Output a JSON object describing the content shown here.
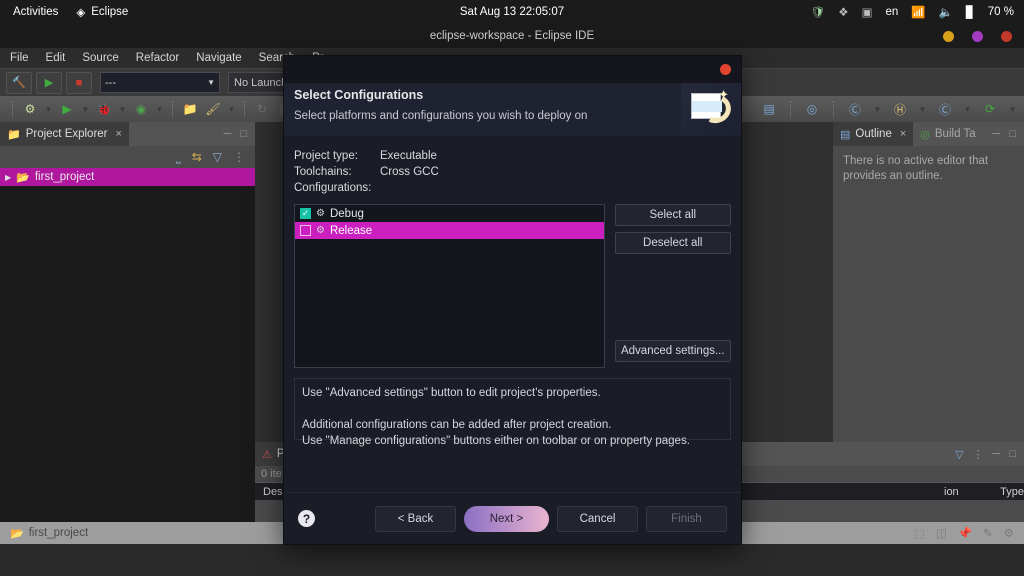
{
  "gnome": {
    "activities": "Activities",
    "app_name": "Eclipse",
    "app_icon": "eclipse-icon",
    "clock": "Sat Aug 13  22:05:07",
    "tray": [
      {
        "name": "shield-icon",
        "glyph": "⬟"
      },
      {
        "name": "dropbox-icon",
        "glyph": "⬡"
      },
      {
        "name": "device-icon",
        "glyph": "▣"
      },
      {
        "name": "keyboard-language",
        "glyph": "en"
      },
      {
        "name": "wifi-icon",
        "glyph": "◠"
      },
      {
        "name": "volume-icon",
        "glyph": "🔊"
      },
      {
        "name": "battery-icon",
        "glyph": "▮"
      }
    ],
    "battery_label": "70 %"
  },
  "window": {
    "title": "eclipse-workspace - Eclipse IDE",
    "buttons": {
      "minimize": "minimize",
      "maximize": "maximize",
      "close": "close"
    }
  },
  "menubar": [
    "File",
    "Edit",
    "Source",
    "Refactor",
    "Navigate",
    "Search",
    "Pr"
  ],
  "toolbar": {
    "build_icon": "hammer-icon",
    "run_icon": "run-icon",
    "stop_icon": "stop-icon",
    "launch_combo_value": "---",
    "launch_config_text": "No Launch Con",
    "row2_icons": [
      {
        "name": "new-c-project-icon",
        "glyph": "⚙"
      },
      {
        "name": "run-icon",
        "glyph": "▶"
      },
      {
        "name": "debug-icon",
        "glyph": "🐞"
      },
      {
        "name": "profile-icon",
        "glyph": "◉"
      },
      {
        "name": "open-resource-icon",
        "glyph": "📂"
      },
      {
        "name": "paintbrush-icon",
        "glyph": "🖌"
      },
      {
        "name": "refresh-icon",
        "glyph": "↻"
      },
      {
        "name": "save-icon",
        "glyph": "▣"
      }
    ],
    "right_icons": [
      {
        "name": "console-icon",
        "glyph": "▤"
      },
      {
        "name": "search-target-icon",
        "glyph": "◎"
      },
      {
        "name": "new-c-class-icon",
        "glyph": "Ⓒ"
      },
      {
        "name": "new-header-icon",
        "glyph": "Ⓗ"
      },
      {
        "name": "new-source-icon",
        "glyph": "Ⓒ"
      },
      {
        "name": "refresh-green-icon",
        "glyph": "⟳"
      }
    ],
    "search_icon": "search-icon",
    "new-perspective-icon": "new-perspective-icon",
    "current_perspective_icon": "c-cpp-perspective-icon"
  },
  "project_explorer": {
    "tab_label": "Project Explorer",
    "tab_icon": "project-explorer-icon",
    "tab_close": "×",
    "toolbar_icons": [
      {
        "name": "collapse-all-icon",
        "glyph": "⊟"
      },
      {
        "name": "link-with-editor-icon",
        "glyph": "⇆"
      },
      {
        "name": "view-filter-icon",
        "glyph": "▽"
      },
      {
        "name": "view-menu-icon",
        "glyph": "⋮"
      }
    ],
    "tree": [
      {
        "label": "first_project",
        "icon": "c-project-icon",
        "expander": "▶",
        "selected": true
      }
    ]
  },
  "outline": {
    "tab_label": "Outline",
    "tab_icon": "outline-icon",
    "tab_close": "×",
    "second_tab_label": "Build Ta",
    "second_tab_icon": "build-targets-icon",
    "message": "There is no active editor that provides an outline.",
    "min_icon": "minimize-icon",
    "max_icon": "maximize-icon"
  },
  "problems": {
    "tab_label": "P",
    "tab_icon": "problems-icon",
    "count_label": "0 ite",
    "columns": [
      "Des",
      "ion",
      "Type"
    ],
    "toolbar_icons": [
      {
        "name": "problems-filter-icon",
        "glyph": "▽"
      },
      {
        "name": "view-menu-icon",
        "glyph": "⋮"
      },
      {
        "name": "minimize-icon",
        "glyph": "−"
      },
      {
        "name": "maximize-icon",
        "glyph": "□"
      }
    ]
  },
  "status_bar": {
    "project_label": "first_project",
    "project_icon": "c-project-icon",
    "right_icons": [
      {
        "name": "smart-insert-icon",
        "glyph": "⬚"
      },
      {
        "name": "memory-icon",
        "glyph": "◫"
      },
      {
        "name": "pin-icon",
        "glyph": "📌"
      },
      {
        "name": "pencil-icon",
        "glyph": "✒"
      },
      {
        "name": "settings-icon",
        "glyph": "⚙"
      }
    ]
  },
  "dialog": {
    "close_button": "close",
    "title": "Select Configurations",
    "subtitle": "Select platforms and configurations you wish to deploy on",
    "banner_icon": "wizard-banner-icon",
    "info": [
      {
        "key": "Project type:",
        "value": "Executable"
      },
      {
        "key": "Toolchains:",
        "value": "Cross GCC"
      },
      {
        "key": "Configurations:",
        "value": ""
      }
    ],
    "configurations": [
      {
        "label": "Debug",
        "checked": true,
        "selected": false,
        "icon": "configuration-icon"
      },
      {
        "label": "Release",
        "checked": false,
        "selected": true,
        "icon": "configuration-icon"
      }
    ],
    "side_buttons": [
      {
        "label": "Select all",
        "name": "select-all-button"
      },
      {
        "label": "Deselect all",
        "name": "deselect-all-button"
      }
    ],
    "advanced_button": "Advanced settings...",
    "description_lines": [
      "Use \"Advanced settings\" button to edit project's properties.",
      "",
      "Additional configurations can be added after project creation.",
      "Use \"Manage configurations\" buttons either on toolbar or on property pages."
    ],
    "help_glyph": "?",
    "footer_buttons": [
      {
        "label": "< Back",
        "name": "back-button",
        "style": "normal"
      },
      {
        "label": "Next >",
        "name": "next-button",
        "style": "primary"
      },
      {
        "label": "Cancel",
        "name": "cancel-button",
        "style": "normal"
      },
      {
        "label": "Finish",
        "name": "finish-button",
        "style": "disabled"
      }
    ]
  },
  "colors": {
    "selection_magenta": "#b0179f",
    "list_selection": "#cb1fc0",
    "checkbox_checked": "#17c1a6",
    "dialog_bg": "#1b1d26",
    "next_gradient_start": "#8b6fc4",
    "next_gradient_end": "#e9b4cf"
  }
}
